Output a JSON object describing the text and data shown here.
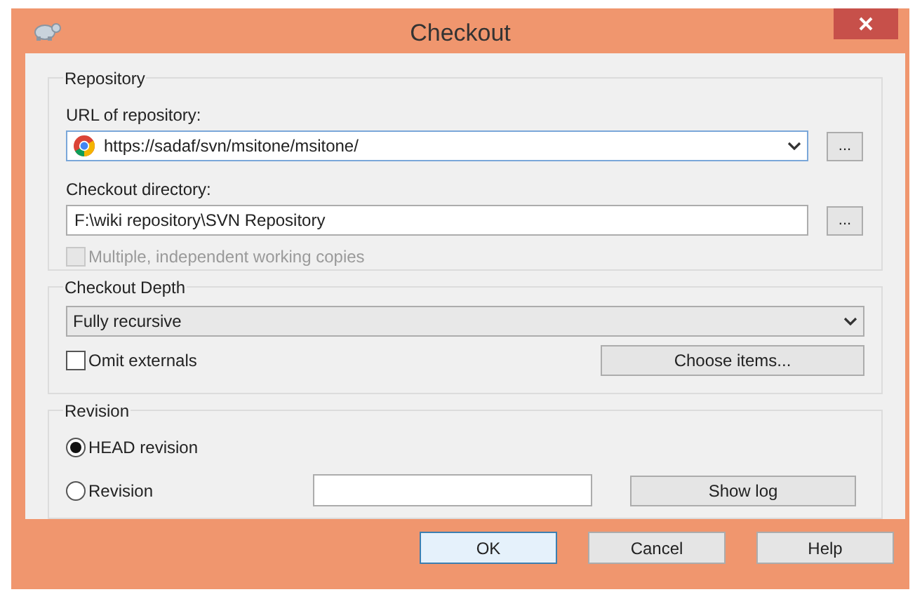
{
  "window": {
    "title": "Checkout"
  },
  "repository": {
    "legend": "Repository",
    "url_label": "URL of repository:",
    "url_value": "https://sadaf/svn/msitone/msitone/",
    "url_browse": "...",
    "dir_label": "Checkout directory:",
    "dir_value": "F:\\wiki repository\\SVN Repository",
    "dir_browse": "...",
    "multiple": {
      "label": "Multiple, independent working copies",
      "checked": false,
      "disabled": true
    }
  },
  "depth": {
    "legend": "Checkout Depth",
    "value": "Fully recursive",
    "omit_externals": {
      "label": "Omit externals",
      "checked": false,
      "disabled": false
    },
    "choose_button": "Choose items..."
  },
  "revision": {
    "legend": "Revision",
    "options": [
      {
        "label": "HEAD revision",
        "selected": true
      },
      {
        "label": "Revision",
        "selected": false
      }
    ],
    "show_log": "Show log"
  },
  "buttons": [
    {
      "label": "OK",
      "default": true
    },
    {
      "label": "Cancel",
      "default": false
    },
    {
      "label": "Help",
      "default": false
    }
  ]
}
